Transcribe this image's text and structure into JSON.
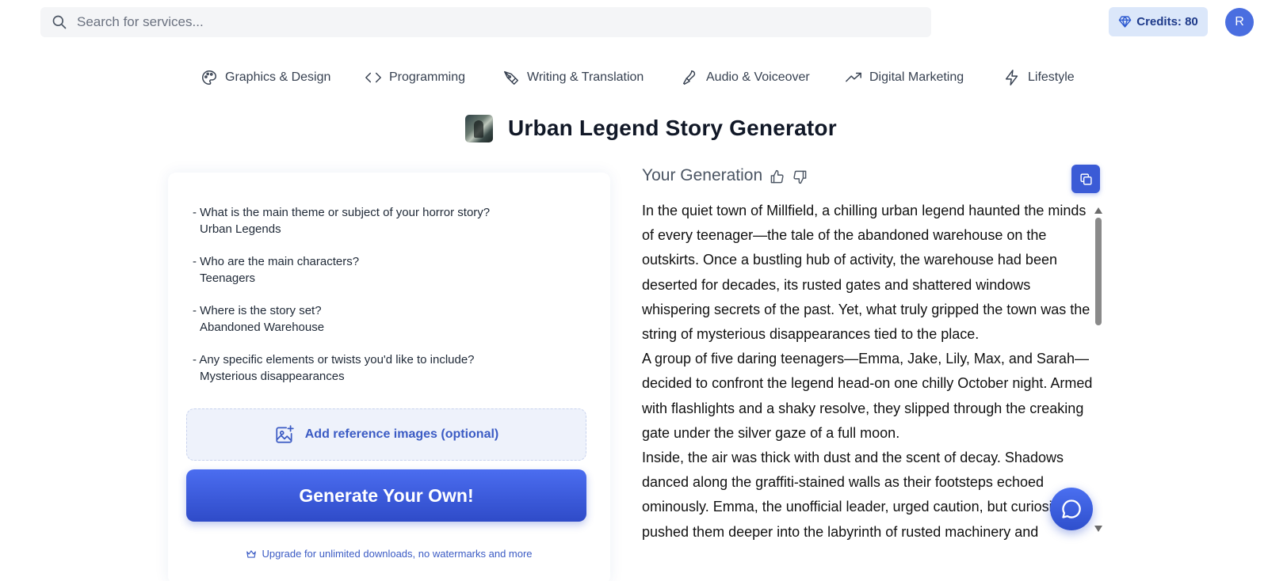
{
  "search": {
    "placeholder": "Search for services..."
  },
  "account": {
    "credits_label": "Credits: 80",
    "avatar_initial": "R"
  },
  "categories": [
    {
      "label": "Graphics & Design",
      "icon": "palette-icon"
    },
    {
      "label": "Programming",
      "icon": "code-icon"
    },
    {
      "label": "Writing & Translation",
      "icon": "pen-tool-icon"
    },
    {
      "label": "Audio & Voiceover",
      "icon": "microphone-icon"
    },
    {
      "label": "Digital Marketing",
      "icon": "trending-up-icon"
    },
    {
      "label": "Lifestyle",
      "icon": "lightning-icon"
    }
  ],
  "page": {
    "title": "Urban Legend Story Generator"
  },
  "inputs": [
    {
      "question": "- What is the main theme or subject of your horror story?",
      "answer": "Urban Legends"
    },
    {
      "question": "- Who are the main characters?",
      "answer": "Teenagers"
    },
    {
      "question": "- Where is the story set?",
      "answer": "Abandoned Warehouse"
    },
    {
      "question": "- Any specific elements or twists you'd like to include?",
      "answer": "Mysterious disappearances"
    }
  ],
  "actions": {
    "add_reference": "Add reference images (optional)",
    "generate": "Generate Your Own!",
    "upgrade": "Upgrade for unlimited downloads, no watermarks and more"
  },
  "generation": {
    "header": "Your Generation",
    "paragraphs": [
      "In the quiet town of Millfield, a chilling urban legend haunted the minds of every teenager—the tale of the abandoned warehouse on the outskirts. Once a bustling hub of activity, the warehouse had been deserted for decades, its rusted gates and shattered windows whispering secrets of the past. Yet, what truly gripped the town was the string of mysterious disappearances tied to the place.",
      "A group of five daring teenagers—Emma, Jake, Lily, Max, and Sarah—decided to confront the legend head-on one chilly October night. Armed with flashlights and a shaky resolve, they slipped through the creaking gate under the silver gaze of a full moon.",
      "Inside, the air was thick with dust and the scent of decay. Shadows danced along the graffiti-stained walls as their footsteps echoed ominously. Emma, the unofficial leader, urged caution, but curiosity pushed them deeper into the labyrinth of rusted machinery and"
    ]
  },
  "colors": {
    "accent": "#3b5bd6",
    "accent_light": "#dbe7fa"
  }
}
